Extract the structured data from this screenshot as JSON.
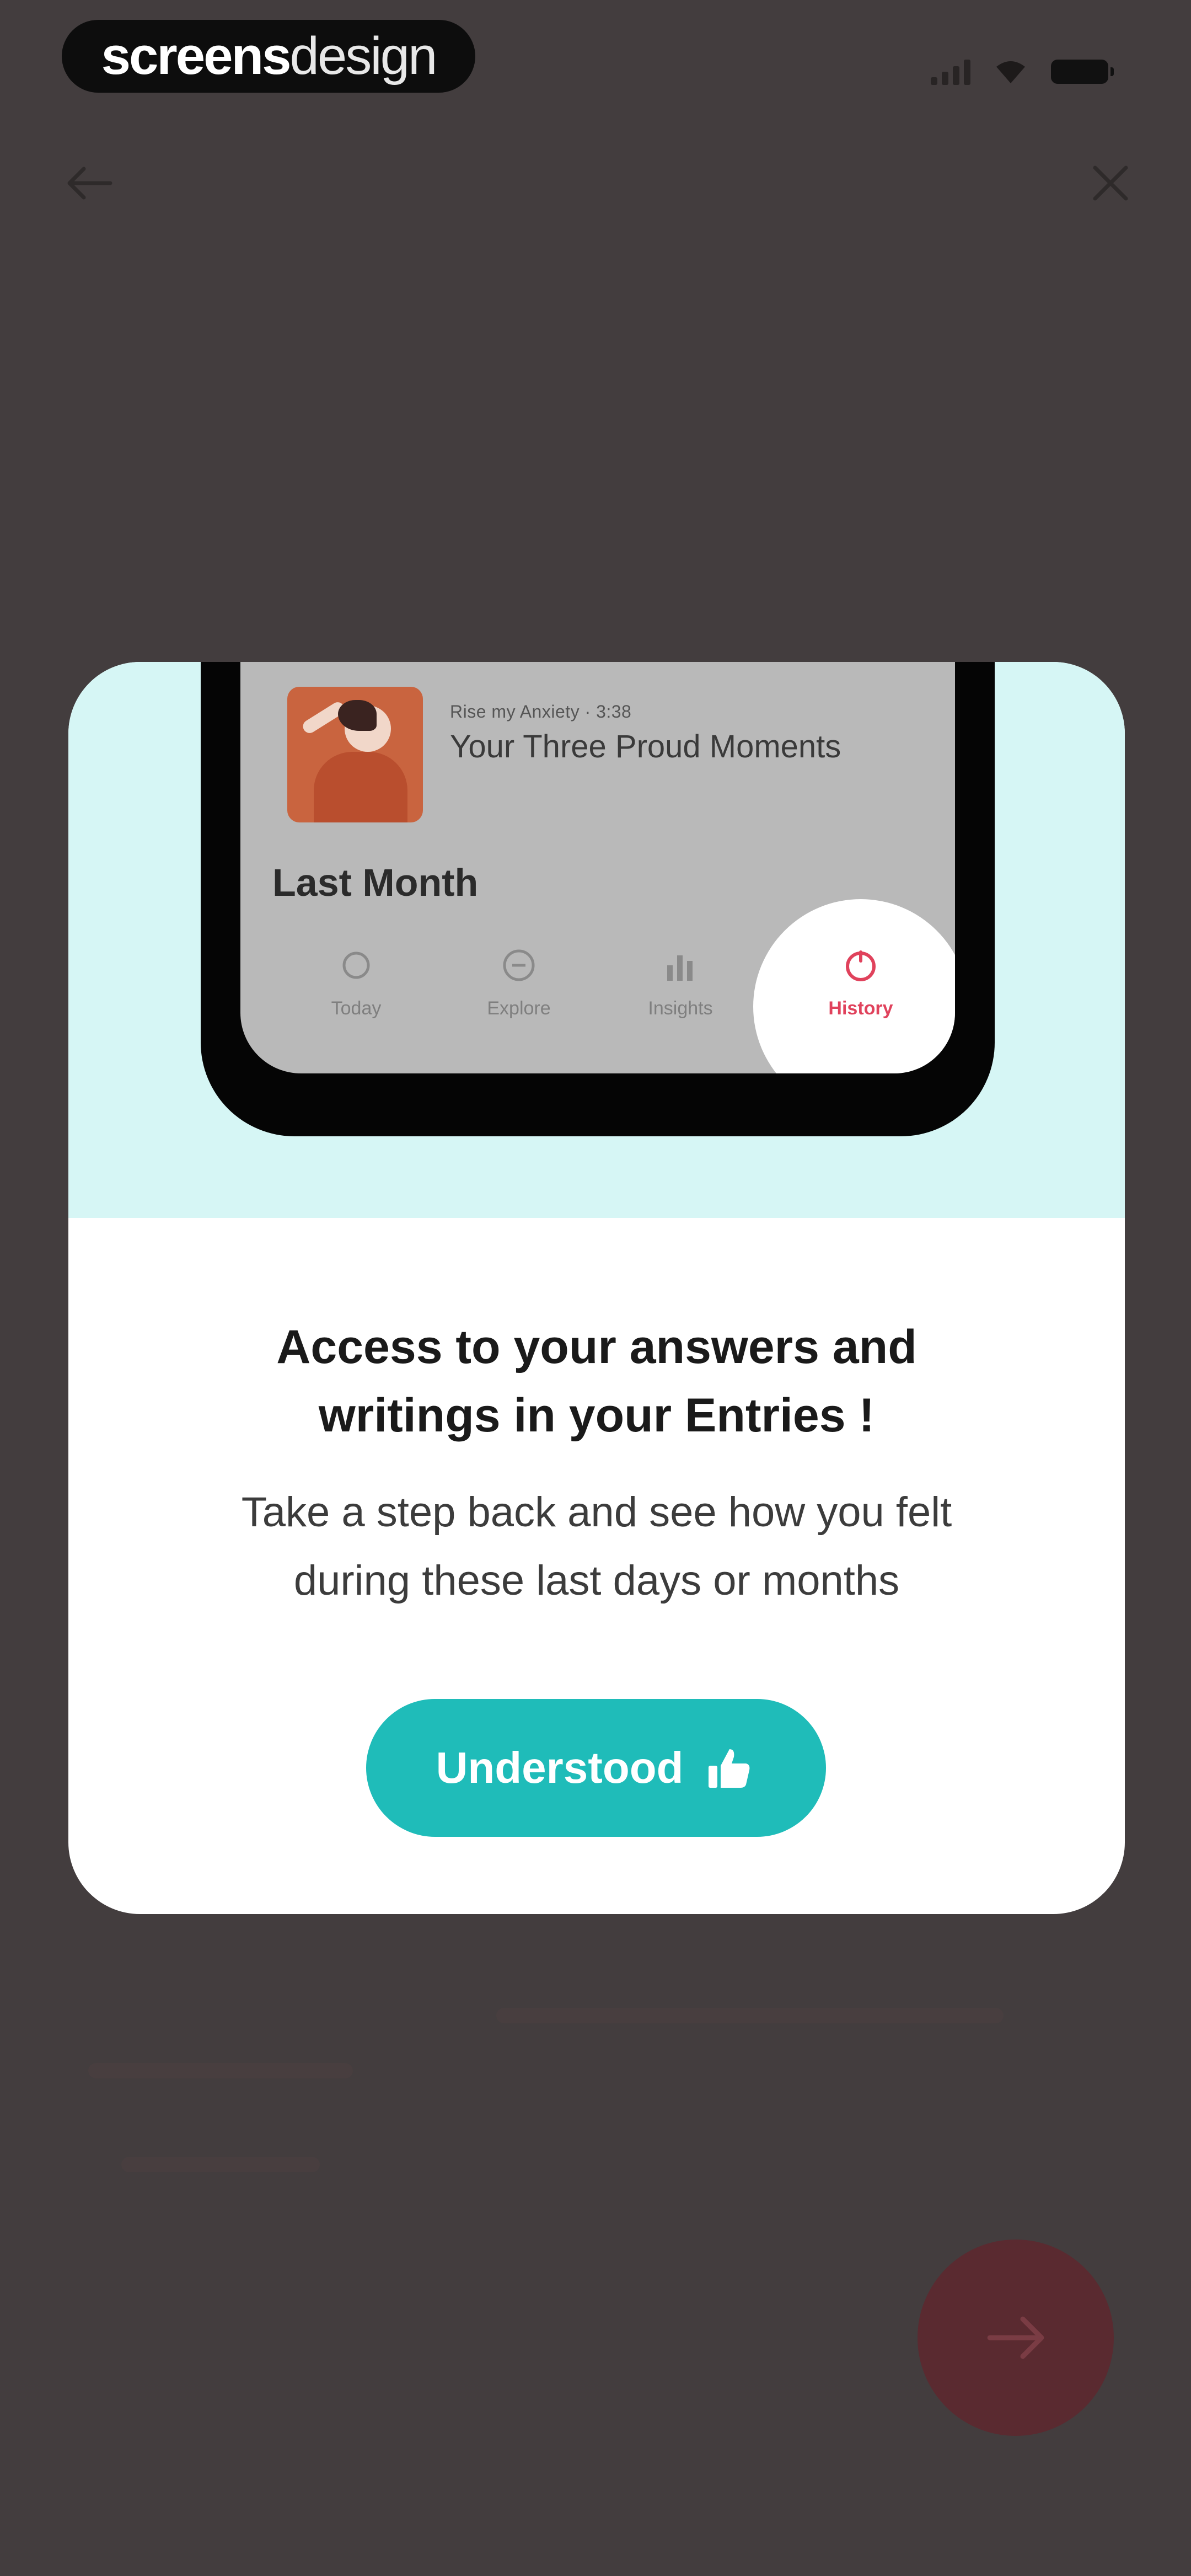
{
  "watermark": {
    "bold": "screens",
    "light": "design"
  },
  "icons": {
    "back": "arrow-left-icon",
    "close": "close-icon",
    "next": "arrow-right-icon",
    "thumbs_up": "thumbs-up-icon",
    "today": "sun-icon",
    "explore": "compass-icon",
    "insights": "bar-chart-icon",
    "history": "clock-icon"
  },
  "preview": {
    "episode_meta": "Rise my Anxiety · 3:38",
    "episode_title": "Your Three Proud Moments",
    "section_heading": "Last Month",
    "tabs": [
      {
        "label": "Today"
      },
      {
        "label": "Explore"
      },
      {
        "label": "Insights"
      },
      {
        "label": "History"
      }
    ]
  },
  "modal": {
    "title_line1": "Access to your answers and",
    "title_line2": "writings in your Entries !",
    "body_line1": "Take a step back and see how you felt",
    "body_line2": "during these last days or months",
    "button_label": "Understood"
  },
  "colors": {
    "accent": "#1fbcb9",
    "history_active": "#e0425c",
    "card_top": "#d6f6f5",
    "overlay": "#433d3e"
  }
}
